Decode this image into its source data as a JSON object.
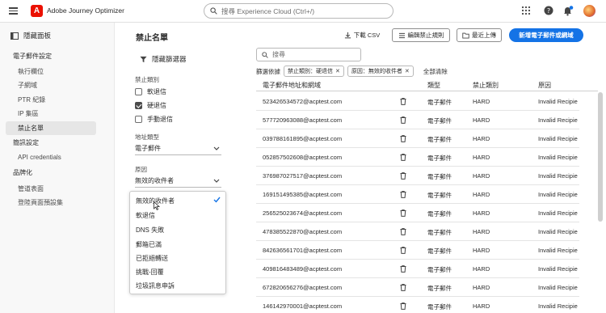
{
  "app": {
    "title": "Adobe Journey Optimizer",
    "logo_letter": "A",
    "search_placeholder": "搜尋 Experience Cloud (Ctrl+/)",
    "brand_color": "#eb1000",
    "accent_color": "#1473e6",
    "top_icons": [
      "apps-grid-icon",
      "help-icon",
      "bell-icon",
      "avatar"
    ]
  },
  "nav": {
    "toggle_label": "隱藏面板",
    "items": [
      {
        "label": "電子郵件設定",
        "type": "section"
      },
      {
        "label": "執行欄位",
        "type": "item"
      },
      {
        "label": "子網域",
        "type": "item"
      },
      {
        "label": "PTR 紀錄",
        "type": "item"
      },
      {
        "label": "IP 集區",
        "type": "item"
      },
      {
        "label": "禁止名單",
        "type": "item",
        "active": true
      },
      {
        "label": "簡訊設定",
        "type": "section"
      },
      {
        "label": "API credentials",
        "type": "item"
      },
      {
        "label": "品牌化",
        "type": "section"
      },
      {
        "label": "管道表面",
        "type": "item"
      },
      {
        "label": "登陸頁面預設集",
        "type": "item"
      }
    ]
  },
  "page": {
    "title": "禁止名單",
    "download_csv": "下載 CSV",
    "edit_rules": "編輯禁止規則",
    "recent_uploads": "最近上傳",
    "new_button": "新增電子郵件或網域"
  },
  "filters": {
    "hide_filters": "隱藏篩選器",
    "category_label": "禁止類別",
    "checks": [
      {
        "label": "軟退信",
        "checked": false
      },
      {
        "label": "硬退信",
        "checked": true
      },
      {
        "label": "手動退信",
        "checked": false
      }
    ],
    "address_type_label": "地址類型",
    "address_type_value": "電子郵件",
    "reason_label": "原因",
    "reason_value": "無效的收件者",
    "reason_options": [
      "無效的收件者",
      "軟退信",
      "DNS 失敗",
      "郵箱已滿",
      "已拒絕轉送",
      "挑戰-回覆",
      "垃圾訊息申訴"
    ],
    "selected_option": "無效的收件者"
  },
  "list": {
    "search_placeholder": "搜尋",
    "applied_label": "篩選依據",
    "tags": [
      "禁止類別：硬退信",
      "原因：無效的收件者"
    ],
    "clear_all": "全部清除",
    "columns": [
      "電子郵件地址和網域",
      "類型",
      "禁止類別",
      "原因"
    ],
    "rows": [
      {
        "email": "523426534572@acptest.com",
        "type": "電子郵件",
        "category": "HARD",
        "reason": "Invalid Recipie"
      },
      {
        "email": "577720963088@acptest.com",
        "type": "電子郵件",
        "category": "HARD",
        "reason": "Invalid Recipie"
      },
      {
        "email": "039788161895@acptest.com",
        "type": "電子郵件",
        "category": "HARD",
        "reason": "Invalid Recipie"
      },
      {
        "email": "052857502608@acptest.com",
        "type": "電子郵件",
        "category": "HARD",
        "reason": "Invalid Recipie"
      },
      {
        "email": "376987027517@acptest.com",
        "type": "電子郵件",
        "category": "HARD",
        "reason": "Invalid Recipie"
      },
      {
        "email": "169151495385@acptest.com",
        "type": "電子郵件",
        "category": "HARD",
        "reason": "Invalid Recipie"
      },
      {
        "email": "256525023674@acptest.com",
        "type": "電子郵件",
        "category": "HARD",
        "reason": "Invalid Recipie"
      },
      {
        "email": "478385522870@acptest.com",
        "type": "電子郵件",
        "category": "HARD",
        "reason": "Invalid Recipie"
      },
      {
        "email": "842636561701@acptest.com",
        "type": "電子郵件",
        "category": "HARD",
        "reason": "Invalid Recipie"
      },
      {
        "email": "409816483489@acptest.com",
        "type": "電子郵件",
        "category": "HARD",
        "reason": "Invalid Recipie"
      },
      {
        "email": "672820656276@acptest.com",
        "type": "電子郵件",
        "category": "HARD",
        "reason": "Invalid Recipie"
      },
      {
        "email": "146142970001@acptest.com",
        "type": "電子郵件",
        "category": "HARD",
        "reason": "Invalid Recipie"
      }
    ]
  }
}
